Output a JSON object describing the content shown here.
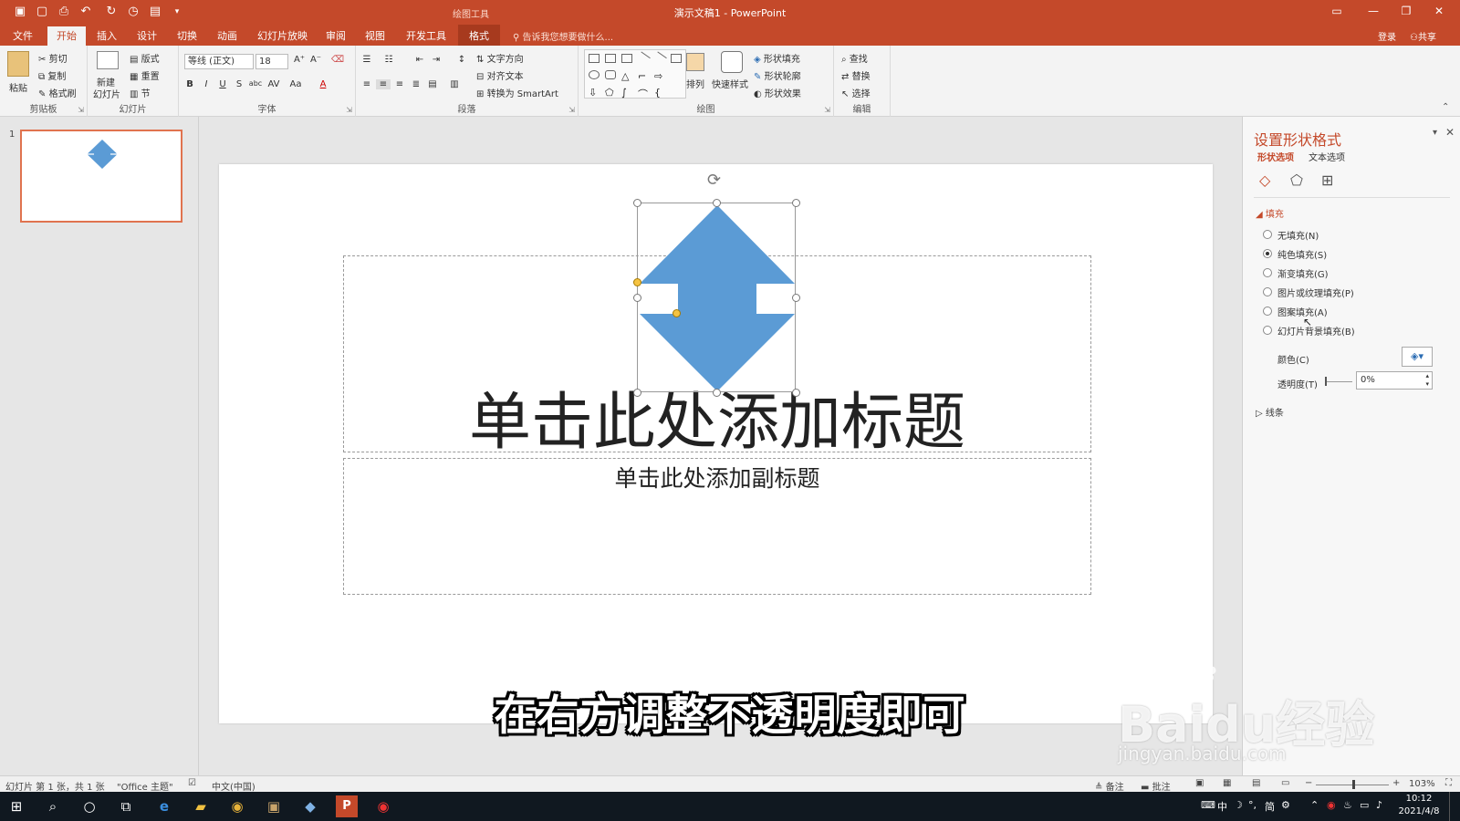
{
  "window": {
    "title": "演示文稿1 - PowerPoint",
    "context_tab_group": "绘图工具",
    "login": "登录",
    "share": "共享"
  },
  "tabs": [
    "文件",
    "开始",
    "插入",
    "设计",
    "切换",
    "动画",
    "幻灯片放映",
    "审阅",
    "视图",
    "开发工具",
    "格式"
  ],
  "tell_me": "告诉我您想要做什么...",
  "ribbon": {
    "clipboard": {
      "label": "剪贴板",
      "paste": "粘贴",
      "cut": "剪切",
      "copy": "复制",
      "painter": "格式刷"
    },
    "slides": {
      "label": "幻灯片",
      "new_slide_1": "新建",
      "new_slide_2": "幻灯片",
      "layout": "版式",
      "reset": "重置",
      "section": "节"
    },
    "font": {
      "label": "字体",
      "font_name": "等线 (正文)",
      "font_size": "18"
    },
    "paragraph": {
      "label": "段落",
      "text_direction": "文字方向",
      "align_text": "对齐文本",
      "smartart": "转换为 SmartArt"
    },
    "drawing": {
      "label": "绘图",
      "arrange": "排列",
      "quick_styles": "快速样式",
      "shape_fill": "形状填充",
      "shape_outline": "形状轮廓",
      "shape_effects": "形状效果"
    },
    "editing": {
      "label": "编辑",
      "find": "查找",
      "replace": "替换",
      "select": "选择"
    }
  },
  "thumbnail": {
    "number": "1"
  },
  "slide": {
    "title_placeholder": "单击此处添加标题",
    "subtitle_placeholder": "单击此处添加副标题",
    "shape_color": "#5b9bd5"
  },
  "format_pane": {
    "title": "设置形状格式",
    "tab_shape": "形状选项",
    "tab_text": "文本选项",
    "section_fill": "填充",
    "options": [
      {
        "label": "无填充(N)",
        "selected": false
      },
      {
        "label": "纯色填充(S)",
        "selected": true
      },
      {
        "label": "渐变填充(G)",
        "selected": false
      },
      {
        "label": "图片或纹理填充(P)",
        "selected": false
      },
      {
        "label": "图案填充(A)",
        "selected": false
      },
      {
        "label": "幻灯片背景填充(B)",
        "selected": false
      }
    ],
    "color_label": "颜色(C)",
    "transparency_label": "透明度(T)",
    "transparency_value": "0%",
    "section_line": "线条"
  },
  "status": {
    "slide_info": "幻灯片 第 1 张，共 1 张",
    "theme": "\"Office 主题\"",
    "language": "中文(中国)",
    "notes": "备注",
    "comments": "批注",
    "zoom": "103%"
  },
  "taskbar": {
    "ime": "中",
    "ime2": "简",
    "time": "10:12",
    "date": "2021/4/8"
  },
  "caption": "在右方调整不透明度即可",
  "watermark": {
    "brand": "Baidu经验",
    "url": "jingyan.baidu.com"
  },
  "colors": {
    "accent": "#c4492a",
    "shape": "#5b9bd5",
    "pane_title": "#c4492a"
  }
}
